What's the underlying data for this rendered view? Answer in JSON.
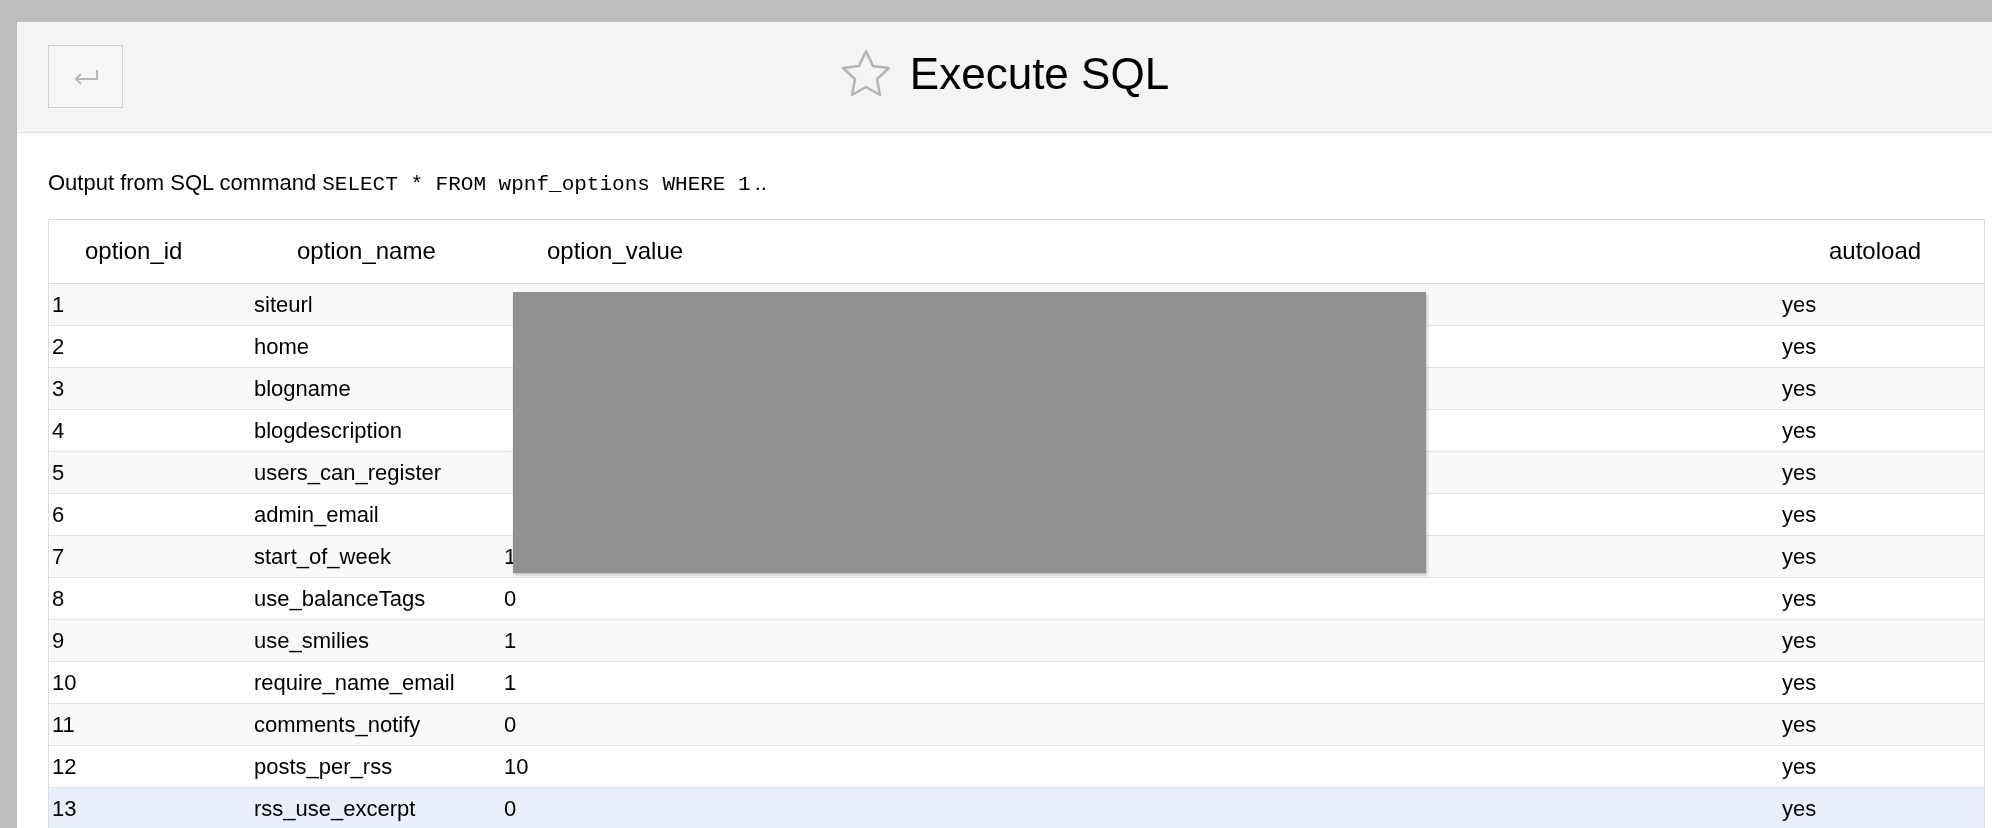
{
  "header": {
    "title": "Execute SQL"
  },
  "output": {
    "prefix": "Output from SQL command",
    "command": "SELECT * FROM wpnf_options WHERE 1",
    "suffix": ".."
  },
  "table": {
    "columns": [
      "option_id",
      "option_name",
      "option_value",
      "autoload"
    ],
    "rows": [
      {
        "option_id": "1",
        "option_name": "siteurl",
        "autoload": "yes",
        "selected": false
      },
      {
        "option_id": "2",
        "option_name": "home",
        "autoload": "yes",
        "selected": false
      },
      {
        "option_id": "3",
        "option_name": "blogname",
        "autoload": "yes",
        "selected": false
      },
      {
        "option_id": "4",
        "option_name": "blogdescription",
        "autoload": "yes",
        "selected": false
      },
      {
        "option_id": "5",
        "option_name": "users_can_register",
        "autoload": "yes",
        "selected": false
      },
      {
        "option_id": "6",
        "option_name": "admin_email",
        "autoload": "yes",
        "selected": false
      },
      {
        "option_id": "7",
        "option_name": "start_of_week",
        "option_value": "1",
        "autoload": "yes",
        "selected": false
      },
      {
        "option_id": "8",
        "option_name": "use_balanceTags",
        "option_value": "0",
        "autoload": "yes",
        "selected": false
      },
      {
        "option_id": "9",
        "option_name": "use_smilies",
        "option_value": "1",
        "autoload": "yes",
        "selected": false
      },
      {
        "option_id": "10",
        "option_name": "require_name_email",
        "option_value": "1",
        "autoload": "yes",
        "selected": false
      },
      {
        "option_id": "11",
        "option_name": "comments_notify",
        "option_value": "0",
        "autoload": "yes",
        "selected": false
      },
      {
        "option_id": "12",
        "option_name": "posts_per_rss",
        "option_value": "10",
        "autoload": "yes",
        "selected": false
      },
      {
        "option_id": "13",
        "option_name": "rss_use_excerpt",
        "option_value": "0",
        "autoload": "yes",
        "selected": true
      }
    ]
  }
}
